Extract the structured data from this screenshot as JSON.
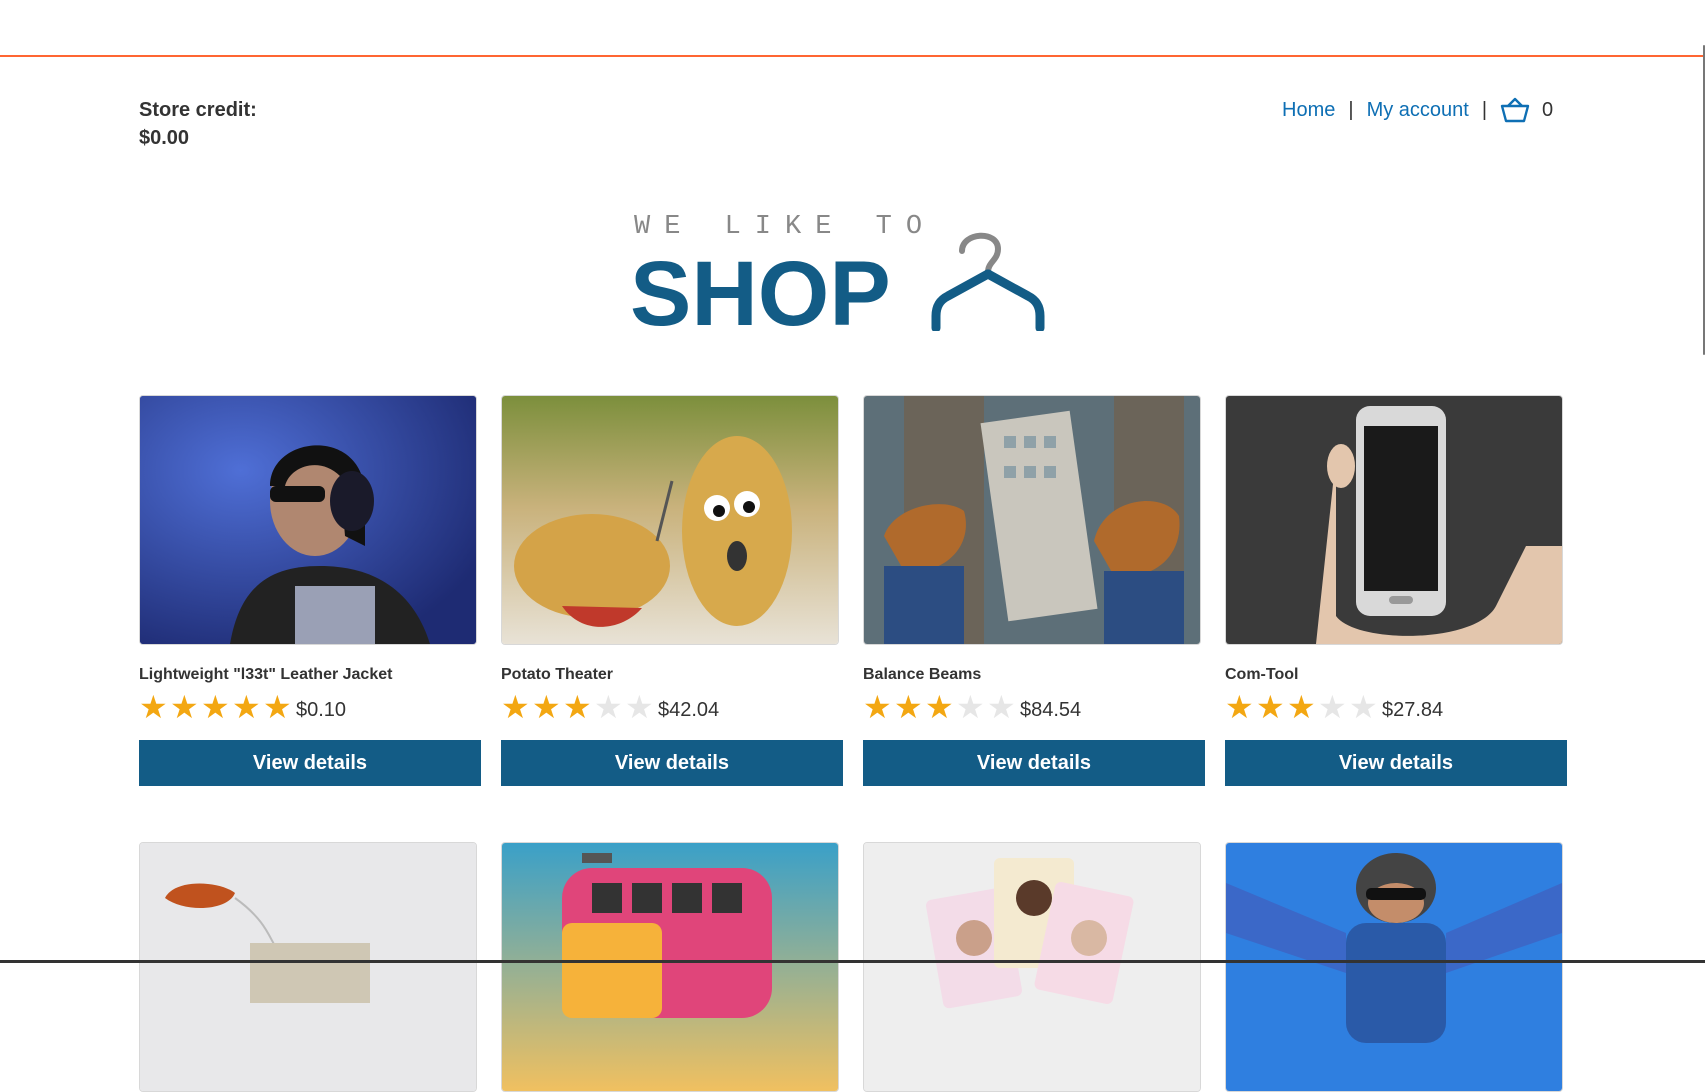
{
  "header": {
    "store_credit_label": "Store credit:",
    "store_credit_value": "$0.00",
    "nav": {
      "home": "Home",
      "separator": "|",
      "my_account": "My account",
      "cart_count": "0"
    }
  },
  "logo": {
    "tagline": "WE LIKE TO",
    "word": "SHOP"
  },
  "colors": {
    "accent": "#ff6633",
    "brand": "#135c86",
    "link": "#0e6fb4",
    "star": "#f3a712"
  },
  "products": [
    {
      "name": "Lightweight \"l33t\" Leather Jacket",
      "rating": 5,
      "price": "$0.10",
      "button": "View details",
      "image": "woman-with-headphones"
    },
    {
      "name": "Potato Theater",
      "rating": 3,
      "price": "$42.04",
      "button": "View details",
      "image": "potatoes"
    },
    {
      "name": "Balance Beams",
      "rating": 3,
      "price": "$84.54",
      "button": "View details",
      "image": "feet-over-city"
    },
    {
      "name": "Com-Tool",
      "rating": 3,
      "price": "$27.84",
      "button": "View details",
      "image": "hand-holding-phone"
    }
  ],
  "products_row2_images": [
    "tea-bag",
    "camper-van",
    "playing-cards",
    "skydivers"
  ]
}
